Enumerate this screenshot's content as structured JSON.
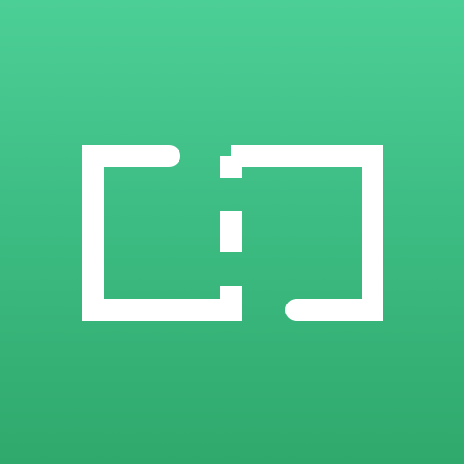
{
  "app": {
    "icon": "bracketed-split-icon",
    "colors": {
      "background_top": "#4ccf96",
      "background_mid": "#3dbd84",
      "background_bottom": "#30a96c",
      "foreground": "#ffffff"
    }
  }
}
